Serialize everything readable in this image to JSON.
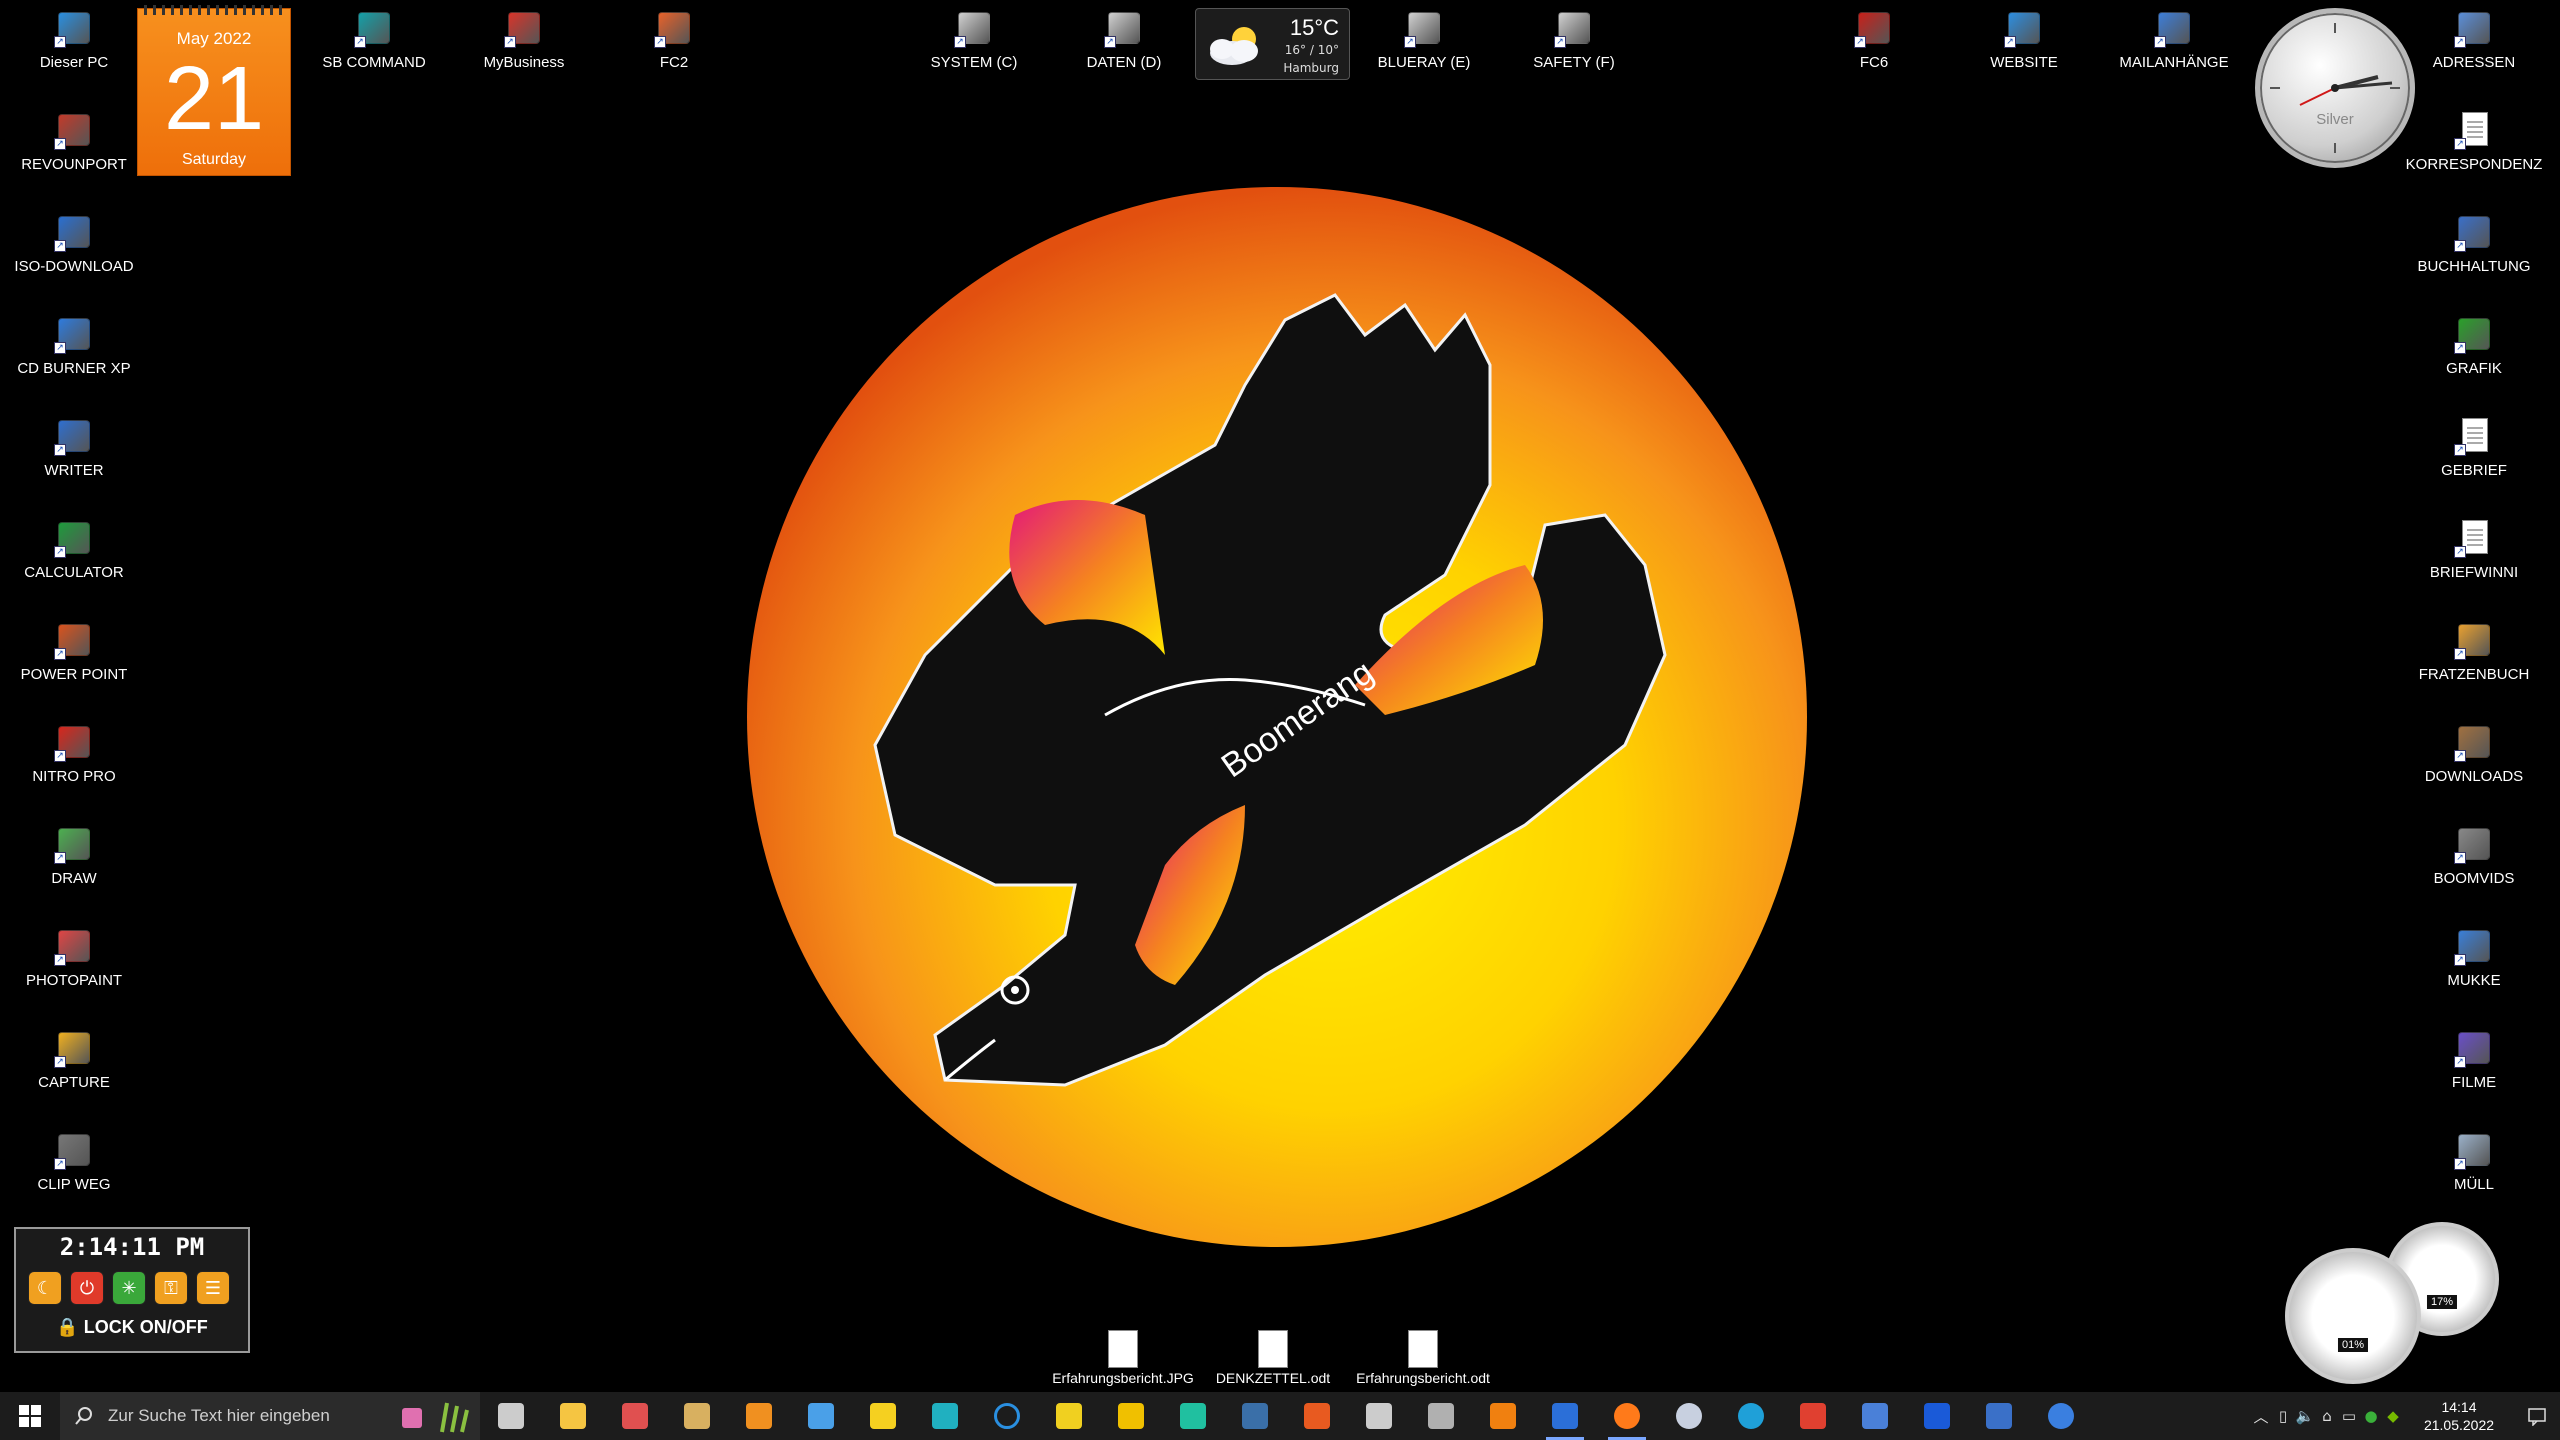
{
  "desktop": {
    "left_icons": [
      {
        "label": "Dieser PC",
        "icon": "computer-icon",
        "color": "#2a8fe0"
      },
      {
        "label": "REVOUNPORT",
        "icon": "uninstall-icon",
        "color": "#c23a2a"
      },
      {
        "label": "ISO-DOWNLOAD",
        "icon": "iso-icon",
        "color": "#2a6fd0"
      },
      {
        "label": "CD BURNER XP",
        "icon": "disc-burner-icon",
        "color": "#2e7bdd"
      },
      {
        "label": "WRITER",
        "icon": "writer-icon",
        "color": "#2f6fcf"
      },
      {
        "label": "CALCULATOR",
        "icon": "spreadsheet-icon",
        "color": "#1e9b3c"
      },
      {
        "label": "POWER POINT",
        "icon": "presentation-icon",
        "color": "#d9531e"
      },
      {
        "label": "NITRO PRO",
        "icon": "pdf-icon",
        "color": "#d8261c"
      },
      {
        "label": "DRAW",
        "icon": "draw-icon",
        "color": "#4caf50"
      },
      {
        "label": "PHOTOPAINT",
        "icon": "camera-icon",
        "color": "#e04545"
      },
      {
        "label": "CAPTURE",
        "icon": "capture-icon",
        "color": "#f0b020"
      },
      {
        "label": "CLIP WEG",
        "icon": "clipboard-icon",
        "color": "#777777"
      }
    ],
    "top_icons": [
      {
        "label": "SB COMMAND",
        "icon": "sb-command-icon",
        "color": "#14a0a8"
      },
      {
        "label": "MyBusiness",
        "icon": "house-icon",
        "color": "#d8342a"
      },
      {
        "label": "FC2",
        "icon": "spiral-icon",
        "color": "#e8622a"
      },
      {
        "label": "SYSTEM (C)",
        "icon": "drive-icon",
        "color": "#d0d0d0"
      },
      {
        "label": "DATEN (D)",
        "icon": "drive-icon",
        "color": "#d0d0d0"
      },
      {
        "label": "BLUERAY (E)",
        "icon": "optical-drive-icon",
        "color": "#d0d0d0"
      },
      {
        "label": "SAFETY (F)",
        "icon": "drive-icon",
        "color": "#d0d0d0"
      },
      {
        "label": "FC6",
        "icon": "fc6-icon",
        "color": "#c8201a"
      },
      {
        "label": "WEBSITE",
        "icon": "web-icon",
        "color": "#2d8ee0"
      },
      {
        "label": "MAILANHÄNGE",
        "icon": "mail-icon",
        "color": "#3d7ed8"
      }
    ],
    "right_icons": [
      {
        "label": "ADRESSEN",
        "icon": "contacts-icon",
        "color": "#5b8ed8"
      },
      {
        "label": "KORRESPONDENZ",
        "icon": "document-icon",
        "color": "#ffffff"
      },
      {
        "label": "BUCHHALTUNG",
        "icon": "ledger-icon",
        "color": "#3a6fc8"
      },
      {
        "label": "GRAFIK",
        "icon": "tree-icon",
        "color": "#2aa02a"
      },
      {
        "label": "GEBRIEF",
        "icon": "document-icon",
        "color": "#ffffff"
      },
      {
        "label": "BRIEFWINNI",
        "icon": "document-icon",
        "color": "#ffffff"
      },
      {
        "label": "FRATZENBUCH",
        "icon": "photo-album-icon",
        "color": "#e8a030"
      },
      {
        "label": "DOWNLOADS",
        "icon": "download-folder-icon",
        "color": "#a07040"
      },
      {
        "label": "BOOMVIDS",
        "icon": "camcorder-icon",
        "color": "#888888"
      },
      {
        "label": "MUKKE",
        "icon": "music-icon",
        "color": "#3a7fd8"
      },
      {
        "label": "FILME",
        "icon": "film-icon",
        "color": "#6a4fc8"
      },
      {
        "label": "MÜLL",
        "icon": "recycle-bin-icon",
        "color": "#9ab0c8"
      }
    ],
    "bottom_files": [
      {
        "label": "Erfahrungsbericht.JPG",
        "icon": "image-file-icon"
      },
      {
        "label": "DENKZETTEL.odt",
        "icon": "odt-file-icon"
      },
      {
        "label": "Erfahrungsbericht.odt",
        "icon": "odt-file-icon"
      }
    ]
  },
  "calendar": {
    "month": "May 2022",
    "day": "21",
    "weekday": "Saturday"
  },
  "weather": {
    "temp": "15°C",
    "range": "16° / 10°",
    "city": "Hamburg"
  },
  "analog_clock": {
    "brand": "Silver"
  },
  "logo": {
    "text": "Boomerang"
  },
  "lock_widget": {
    "time": "2:14:11 PM",
    "lock_label": "LOCK ON/OFF"
  },
  "gauges": {
    "left_pct": "01%",
    "right_pct": "17%"
  },
  "taskbar": {
    "search_placeholder": "Zur Suche Text hier eingeben",
    "apps": [
      {
        "name": "task-view-icon",
        "color": "#cccccc"
      },
      {
        "name": "file-explorer-icon",
        "color": "#f5c542"
      },
      {
        "name": "paint-palette-icon",
        "color": "#e05050"
      },
      {
        "name": "scanner-icon",
        "color": "#d8b060"
      },
      {
        "name": "pen-icon",
        "color": "#f09020"
      },
      {
        "name": "app-window-icon",
        "color": "#4aa0e8"
      },
      {
        "name": "sticky-notes-icon",
        "color": "#f5d020"
      },
      {
        "name": "keyboard-icon",
        "color": "#20b0c0"
      },
      {
        "name": "cortana-icon",
        "color": "#2a8fe0"
      },
      {
        "name": "notes-icon",
        "color": "#f0d020"
      },
      {
        "name": "norton-icon",
        "color": "#f0c000"
      },
      {
        "name": "brain-icon",
        "color": "#20c0a0"
      },
      {
        "name": "steam-icon",
        "color": "#3a6fa8"
      },
      {
        "name": "location-icon",
        "color": "#e85a20"
      },
      {
        "name": "aperture-icon",
        "color": "#cccccc"
      },
      {
        "name": "video-editor-icon",
        "color": "#b0b0b0"
      },
      {
        "name": "vlc-icon",
        "color": "#f08010"
      },
      {
        "name": "word-icon",
        "color": "#2b6fd8",
        "active": true
      },
      {
        "name": "firefox-icon",
        "color": "#ff7a1a",
        "active": true
      },
      {
        "name": "ball-icon",
        "color": "#c8d0e0"
      },
      {
        "name": "edge-icon",
        "color": "#1fa0d8"
      },
      {
        "name": "firewall-icon",
        "color": "#e04030"
      },
      {
        "name": "settings-gear-icon",
        "color": "#4a80d8"
      },
      {
        "name": "malwarebytes-icon",
        "color": "#1a5ad8"
      },
      {
        "name": "dev-tool-icon",
        "color": "#3a70c8"
      },
      {
        "name": "blue-circle-icon",
        "color": "#3a7fe0"
      }
    ],
    "tray_time": "14:14",
    "tray_date": "21.05.2022"
  }
}
